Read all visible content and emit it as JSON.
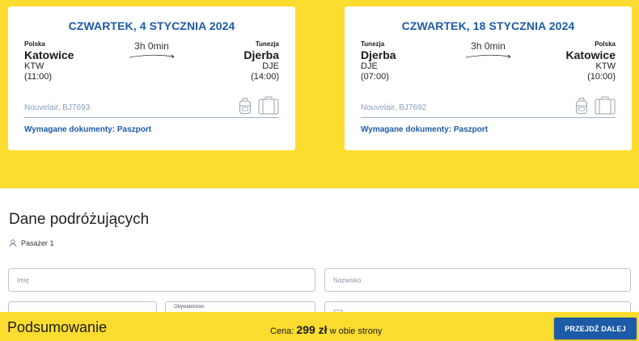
{
  "flights": {
    "outbound": {
      "date": "CZWARTEK, 4 STYCZNIA 2024",
      "from": {
        "country": "Polska",
        "city": "Katowice",
        "code": "KTW",
        "time": "(11:00)"
      },
      "to": {
        "country": "Tunezja",
        "city": "Djerba",
        "code": "DJE",
        "time": "(14:00)"
      },
      "duration": "3h 0min",
      "carrier": "Nouvelair, BJ7693",
      "documents": "Wymagane dokumenty: Paszport"
    },
    "return": {
      "date": "CZWARTEK, 18 STYCZNIA 2024",
      "from": {
        "country": "Tunezja",
        "city": "Djerba",
        "code": "DJE",
        "time": "(07:00)"
      },
      "to": {
        "country": "Polska",
        "city": "Katowice",
        "code": "KTW",
        "time": "(10:00)"
      },
      "duration": "3h 0min",
      "carrier": "Nouvelair, BJ7692",
      "documents": "Wymagane dokumenty: Paszport"
    }
  },
  "travelers": {
    "title": "Dane podróżujących",
    "passenger_label": "Pasażer 1",
    "fields": {
      "first_name_placeholder": "Imię",
      "last_name_placeholder": "Nazwisko",
      "nationality_label": "Obywatelstwo"
    }
  },
  "summary": {
    "title": "Podsumowanie",
    "price_prefix": "Cena:",
    "price_amount": "299 zł",
    "price_suffix": "w obie strony",
    "next_button": "PRZEJDŹ DALEJ"
  },
  "colors": {
    "accent_yellow": "#fcdc2e",
    "brand_blue": "#1d5ba6"
  }
}
